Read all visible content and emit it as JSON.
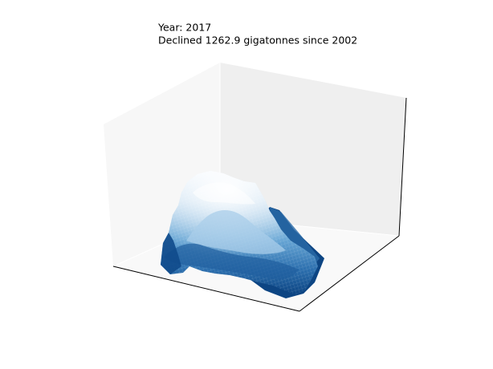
{
  "chart_data": {
    "type": "surface3d",
    "title_lines": [
      "Year: 2017",
      "Declined 1262.9 gigatonnes since 2002"
    ],
    "colormap": "Blues",
    "axes_visible": false,
    "grid": false,
    "pane_colors": {
      "left": "#f7f7f7",
      "back": "#efefef",
      "floor": "#f9f9f9"
    },
    "surface_colors": {
      "peak": "#f4f9fe",
      "mid": "#7ab4db",
      "low": "#1e5d9c",
      "base": "#0b3f7a"
    }
  }
}
